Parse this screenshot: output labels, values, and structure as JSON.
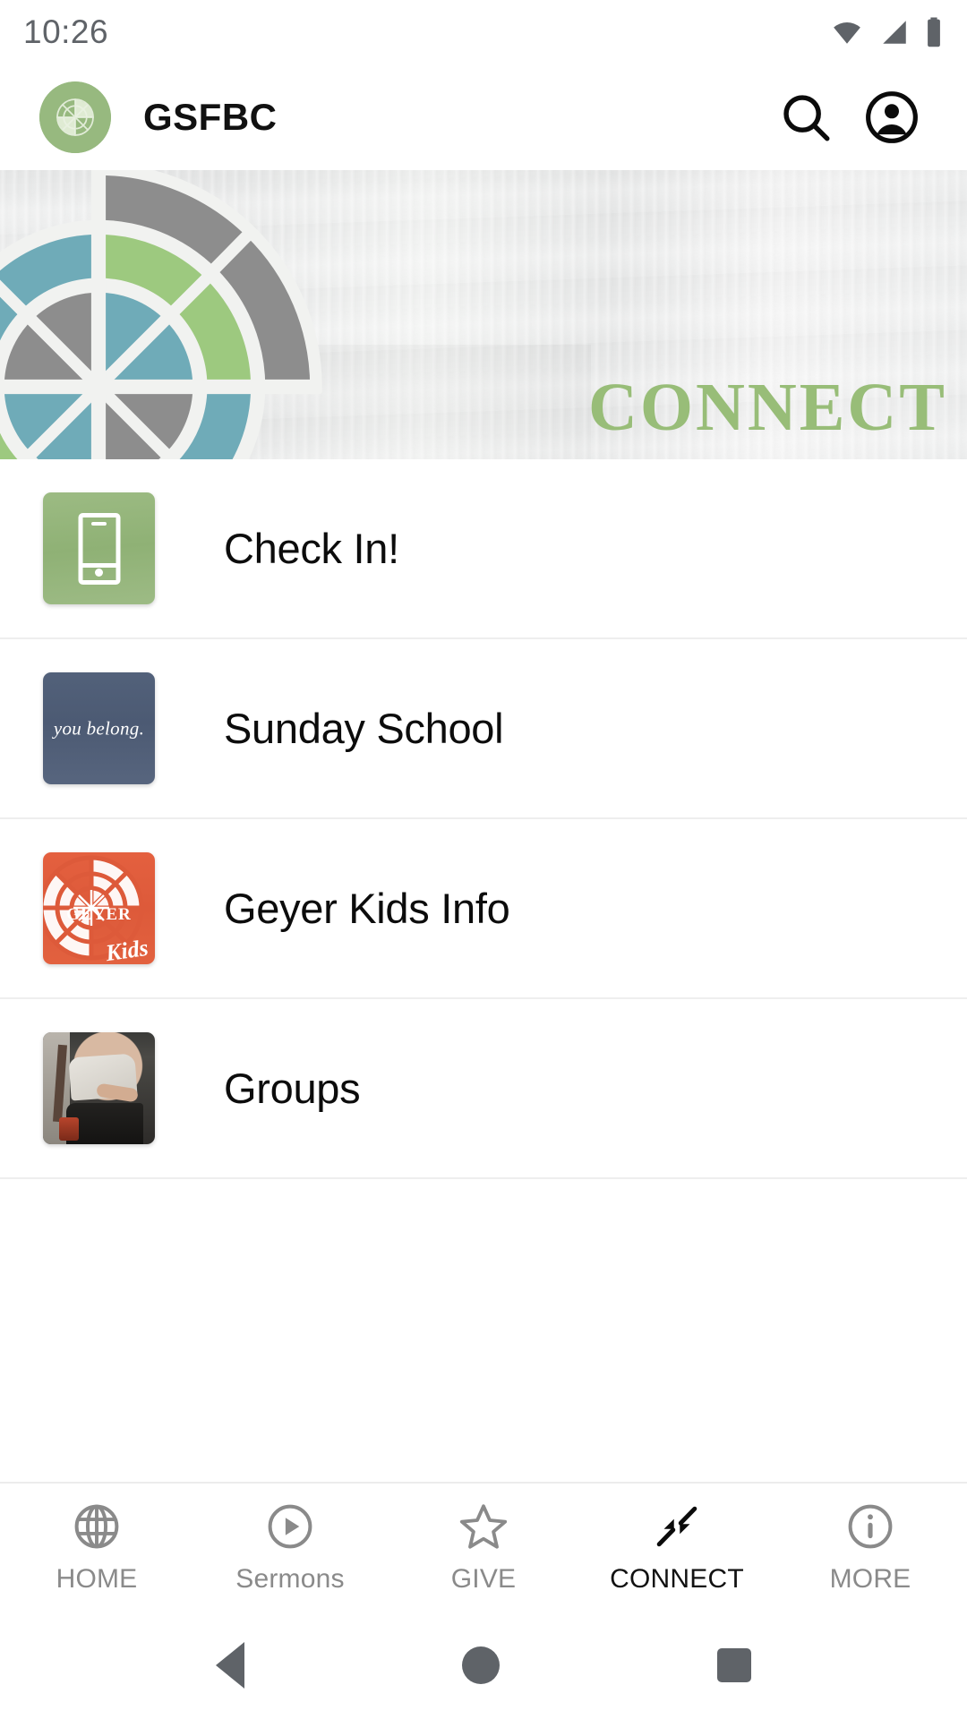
{
  "status_bar": {
    "time": "10:26",
    "icons": [
      "wifi-icon",
      "cellular-signal-icon",
      "battery-icon"
    ]
  },
  "app_bar": {
    "logo_icon": "gsfbc-compass-logo",
    "title": "GSFBC",
    "search_icon": "search-icon",
    "account_icon": "account-circle-icon"
  },
  "hero": {
    "banner_word": "CONNECT",
    "banner_word_color": "#98bd78",
    "graphic": "radial-compass-wheel",
    "segment_colors": [
      "#6fabb8",
      "#9dc97f",
      "#898989"
    ]
  },
  "list": {
    "items": [
      {
        "label": "Check In!",
        "thumb_name": "check-in-thumbnail",
        "thumb_kind": "phone-glyph",
        "thumb_color": "#8fb175"
      },
      {
        "label": "Sunday School",
        "thumb_name": "sunday-school-thumbnail",
        "thumb_kind": "you-belong",
        "thumb_color": "#4c5a73",
        "thumb_text": "you belong."
      },
      {
        "label": "Geyer Kids Info",
        "thumb_name": "geyer-kids-thumbnail",
        "thumb_kind": "geyer-kids-logo",
        "thumb_color": "#dd5a3a",
        "thumb_text": "GEYER",
        "thumb_text2": "Kids"
      },
      {
        "label": "Groups",
        "thumb_name": "groups-thumbnail",
        "thumb_kind": "photo",
        "thumb_color": "#3a3a38"
      }
    ]
  },
  "tab_bar": {
    "active": "CONNECT",
    "tabs": [
      {
        "label": "HOME",
        "icon": "globe-icon"
      },
      {
        "label": "Sermons",
        "icon": "play-circle-icon"
      },
      {
        "label": "GIVE",
        "icon": "star-icon"
      },
      {
        "label": "CONNECT",
        "icon": "connect-arrows-icon"
      },
      {
        "label": "MORE",
        "icon": "info-circle-icon"
      }
    ]
  },
  "system_nav": {
    "back_icon": "back-triangle-icon",
    "home_icon": "home-circle-icon",
    "recents_icon": "recents-square-icon"
  }
}
